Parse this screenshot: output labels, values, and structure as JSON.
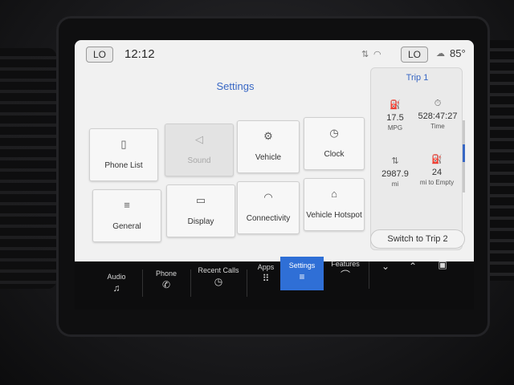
{
  "status": {
    "left_chip": "LO",
    "time": "12:12",
    "right_chip": "LO",
    "temperature": "85°"
  },
  "settings": {
    "title": "Settings",
    "tiles": [
      {
        "label": "Phone List",
        "icon": "phone-list-icon",
        "glyph": "▯",
        "enabled": true
      },
      {
        "label": "Sound",
        "icon": "speaker-icon",
        "glyph": "◁",
        "enabled": false
      },
      {
        "label": "Vehicle",
        "icon": "vehicle-icon",
        "glyph": "⚙",
        "enabled": true
      },
      {
        "label": "Clock",
        "icon": "clock-icon",
        "glyph": "◷",
        "enabled": true
      },
      {
        "label": "General",
        "icon": "sliders-icon",
        "glyph": "≡",
        "enabled": true
      },
      {
        "label": "Display",
        "icon": "display-icon",
        "glyph": "▭",
        "enabled": true
      },
      {
        "label": "Connectivity",
        "icon": "wifi-icon",
        "glyph": "◠",
        "enabled": true
      },
      {
        "label": "Vehicle Hotspot",
        "icon": "hotspot-icon",
        "glyph": "⌂",
        "enabled": true
      }
    ]
  },
  "trip": {
    "title": "Trip 1",
    "mpg_value": "17.5",
    "mpg_unit": "MPG",
    "time_value": "528:47:27",
    "time_unit": "Time",
    "distance_value": "2987.9",
    "distance_unit": "mi",
    "empty_value": "24",
    "empty_unit": "mi to Empty",
    "switch_label": "Switch to Trip 2"
  },
  "nav": {
    "items": [
      {
        "label": "Audio",
        "glyph": "♫"
      },
      {
        "label": "Phone",
        "glyph": "✆"
      },
      {
        "label": "Recent Calls",
        "glyph": "◷"
      },
      {
        "label": "Apps",
        "glyph": "⠿"
      },
      {
        "label": "Settings",
        "glyph": "≡"
      },
      {
        "label": "Features",
        "glyph": "⌒"
      }
    ],
    "active": "Settings"
  },
  "colors": {
    "accent": "#2f6fd6",
    "title_blue": "#3867c4"
  }
}
